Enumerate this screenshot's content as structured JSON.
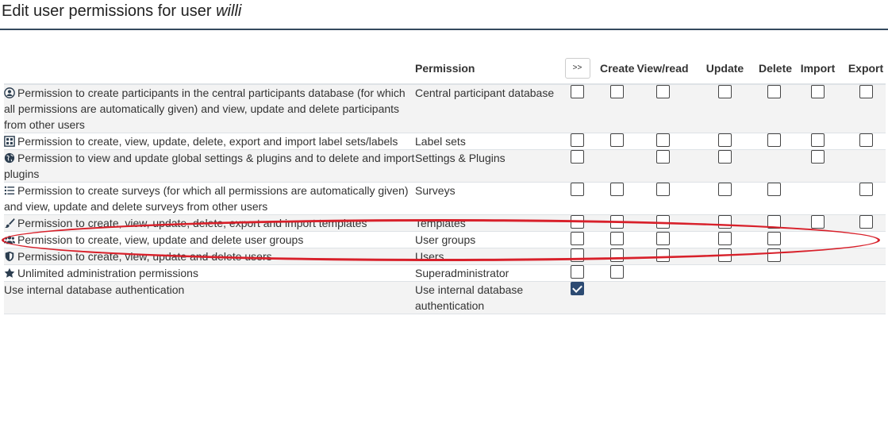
{
  "page": {
    "title_prefix": "Edit user permissions for user",
    "username": "willi"
  },
  "table": {
    "headers": {
      "permission": "Permission",
      "toggle_all": ">>",
      "create": "Create",
      "read": "View/read",
      "update": "Update",
      "delete": "Delete",
      "import": "Import",
      "export": "Export"
    },
    "rows": [
      {
        "icon": "user-circle-icon",
        "description": "Permission to create participants in the central participants database (for which all permissions are automatically given) and view, update and delete participants from other users",
        "permission": "Central participant database",
        "checks": {
          "all": false,
          "create": false,
          "read": false,
          "update": false,
          "delete": false,
          "import": false,
          "export": false
        }
      },
      {
        "icon": "label-sets-icon",
        "description": "Permission to create, view, update, delete, export and import label sets/labels",
        "permission": "Label sets",
        "checks": {
          "all": false,
          "create": false,
          "read": false,
          "update": false,
          "delete": false,
          "import": false,
          "export": false
        }
      },
      {
        "icon": "globe-icon",
        "description": "Permission to view and update global settings & plugins and to delete and import plugins",
        "permission": "Settings & Plugins",
        "checks": {
          "all": false,
          "read": false,
          "update": false,
          "import": false
        }
      },
      {
        "icon": "list-icon",
        "description": "Permission to create surveys (for which all permissions are automatically given) and view, update and delete surveys from other users",
        "permission": "Surveys",
        "checks": {
          "all": false,
          "create": false,
          "read": false,
          "update": false,
          "delete": false,
          "export": false
        }
      },
      {
        "icon": "brush-icon",
        "description": "Permission to create, view, update, delete, export and import templates",
        "permission": "Templates",
        "checks": {
          "all": false,
          "create": false,
          "read": false,
          "update": false,
          "delete": false,
          "import": false,
          "export": false
        }
      },
      {
        "icon": "users-icon",
        "description": "Permission to create, view, update and delete user groups",
        "permission": "User groups",
        "checks": {
          "all": false,
          "create": false,
          "read": false,
          "update": false,
          "delete": false
        }
      },
      {
        "icon": "shield-icon",
        "description": "Permission to create, view, update and delete users",
        "permission": "Users",
        "checks": {
          "all": false,
          "create": false,
          "read": false,
          "update": false,
          "delete": false
        }
      },
      {
        "icon": "star-icon",
        "description": "Unlimited administration permissions",
        "permission": "Superadministrator",
        "checks": {
          "all": false,
          "create": false
        }
      },
      {
        "icon": "",
        "description": "Use internal database authentication",
        "permission": "Use internal database authentication",
        "checks": {
          "all": true
        }
      }
    ]
  },
  "annotation": {
    "highlight_color": "#d8202a",
    "highlighted_row_permission": "Surveys"
  },
  "colors": {
    "accent": "#2c4a72",
    "title_rule": "#34495e",
    "row_stripe": "#f3f3f3"
  }
}
